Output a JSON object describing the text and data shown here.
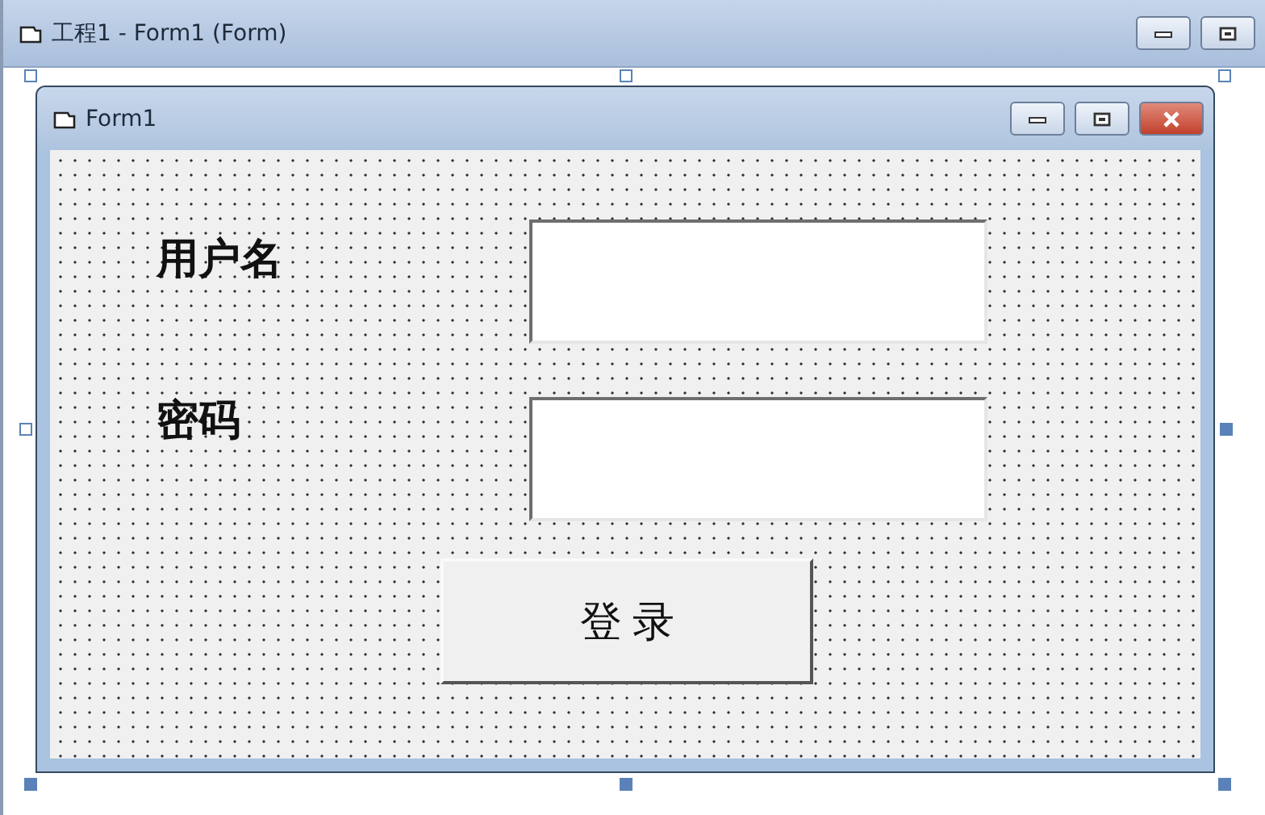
{
  "window": {
    "title": "工程1 - Form1 (Form)"
  },
  "form": {
    "title": "Form1",
    "controls": [
      {
        "kind": "label",
        "text": "用户名"
      },
      {
        "kind": "textbox"
      },
      {
        "kind": "label",
        "text": "密码"
      },
      {
        "kind": "textbox"
      },
      {
        "kind": "button",
        "text": "登 录"
      }
    ]
  }
}
